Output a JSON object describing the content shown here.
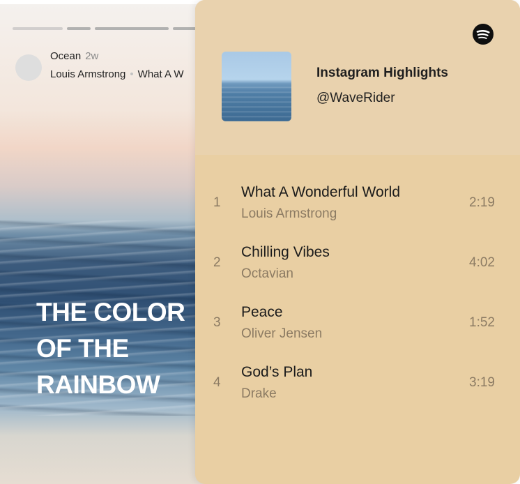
{
  "story": {
    "account": "Ocean",
    "time": "2w",
    "artist": "Louis Armstrong",
    "song": "What A W",
    "headline": "THE COLOR\nOF THE\nRAINBOW"
  },
  "panel": {
    "playlist_title": "Instagram Highlights",
    "playlist_user": "@WaveRider",
    "tracks": [
      {
        "num": "1",
        "name": "What A Wonderful World",
        "artist": "Louis Armstrong",
        "duration": "2:19"
      },
      {
        "num": "2",
        "name": "Chilling Vibes",
        "artist": "Octavian",
        "duration": "4:02"
      },
      {
        "num": "3",
        "name": "Peace",
        "artist": "Oliver Jensen",
        "duration": "1:52"
      },
      {
        "num": "4",
        "name": "God’s Plan",
        "artist": "Drake",
        "duration": "3:19"
      }
    ]
  },
  "icons": {
    "spotify": "spotify-icon"
  },
  "colors": {
    "panel_bg": "#e9cfa3",
    "panel_header_bg": "#e9d2ae",
    "muted_text": "#8c7b63"
  }
}
